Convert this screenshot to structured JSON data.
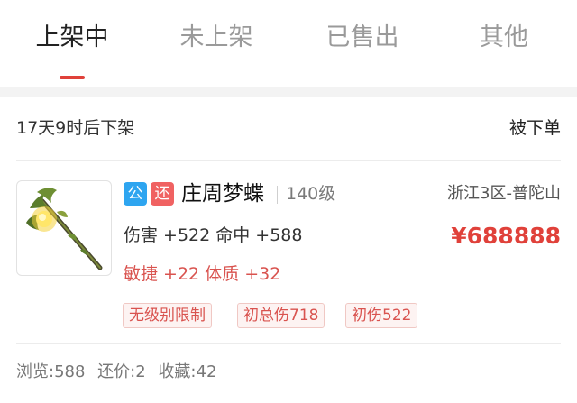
{
  "tabs": [
    {
      "label": "上架中",
      "active": true
    },
    {
      "label": "未上架",
      "active": false
    },
    {
      "label": "已售出",
      "active": false
    },
    {
      "label": "其他",
      "active": false
    }
  ],
  "listing": {
    "countdown": "17天9时后下架",
    "action_label": "被下单",
    "badges": {
      "gong": "公",
      "huan": "还"
    },
    "item_name": "庄周梦蝶",
    "level": "140级",
    "server": "浙江3区-普陀山",
    "stats_line1": "伤害 +522 命中 +588",
    "stats_line2": "敏捷 +22 体质 +32",
    "price": "¥688888",
    "tags": [
      "无级别限制",
      "初总伤718",
      "初伤522"
    ],
    "views": "浏览:588",
    "bargains": "还价:2",
    "favorites": "收藏:42",
    "thumbnail_icon": "staff-weapon-icon"
  },
  "colors": {
    "accent_red": "#e0413a",
    "badge_blue": "#2ea5f0",
    "badge_red": "#f06262"
  }
}
